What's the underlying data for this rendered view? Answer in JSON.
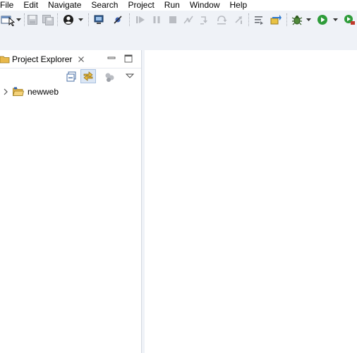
{
  "menubar": {
    "items": [
      {
        "label": "File"
      },
      {
        "label": "Edit"
      },
      {
        "label": "Navigate"
      },
      {
        "label": "Search"
      },
      {
        "label": "Project"
      },
      {
        "label": "Run"
      },
      {
        "label": "Window"
      },
      {
        "label": "Help"
      }
    ]
  },
  "toolbar": {
    "icons": [
      "new-icon",
      "dropdown-icon",
      "save-icon",
      "save-all-icon",
      "person-icon",
      "dropdown-icon",
      "monitor-icon",
      "skip-breakpoints-icon",
      "resume-icon",
      "suspend-icon",
      "terminate-icon",
      "disconnect-icon",
      "step-into-icon",
      "step-over-icon",
      "step-return-icon",
      "use-step-filters-icon",
      "open-task-icon",
      "debug-icon",
      "run-icon",
      "coverage-icon"
    ]
  },
  "explorer": {
    "title": "Project Explorer",
    "tree": [
      {
        "label": "newweb",
        "expanded": false
      }
    ]
  },
  "colors": {
    "chrome": "#eff2f7",
    "panel": "#ffffff",
    "run_green": "#2e9c3a",
    "folder_yellow": "#e8b84b"
  }
}
